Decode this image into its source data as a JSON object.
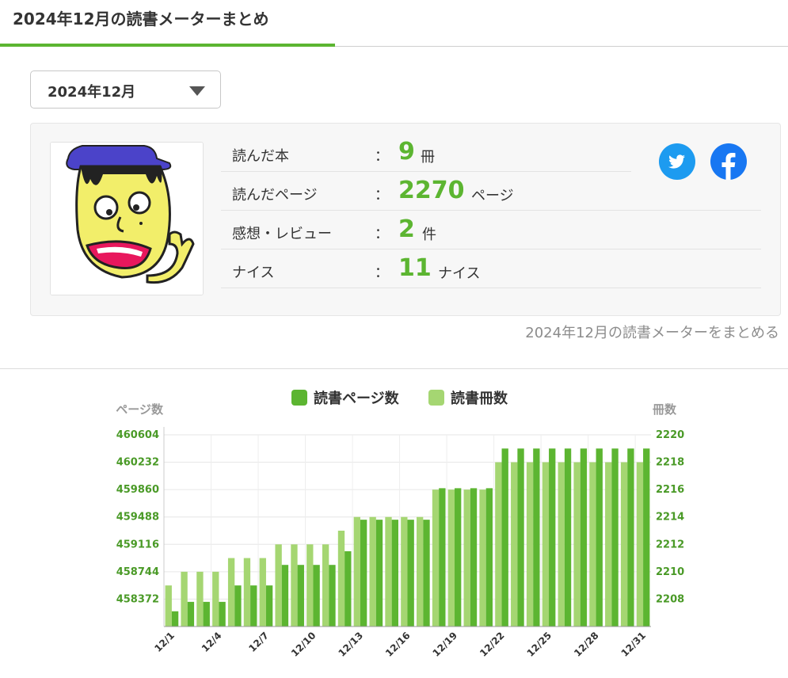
{
  "header": {
    "title": "2024年12月の読書メーターまとめ"
  },
  "month_select": {
    "value": "2024年12月"
  },
  "stats": [
    {
      "label": "読んだ本",
      "colon": "：",
      "value": "9",
      "unit": "冊"
    },
    {
      "label": "読んだページ",
      "colon": "：",
      "value": "2270",
      "unit": "ページ"
    },
    {
      "label": "感想・レビュー",
      "colon": "：",
      "value": "2",
      "unit": "件"
    },
    {
      "label": "ナイス",
      "colon": "：",
      "value": "11",
      "unit": "ナイス"
    }
  ],
  "social": [
    {
      "name": "twitter-icon"
    },
    {
      "name": "facebook-icon"
    }
  ],
  "summarize_link": "2024年12月の読書メーターをまとめる",
  "colors": {
    "accent": "#5cb531",
    "pages_series": "#5cb531",
    "books_series": "#a5d672",
    "twitter": "#1d9bf0",
    "facebook": "#1877f2"
  },
  "chart_data": {
    "type": "bar",
    "legend": [
      "読書ページ数",
      "読書冊数"
    ],
    "legend_position": "top-center",
    "ylabel_left": "ページ数",
    "ylabel_right": "冊数",
    "yticks_left": [
      "460604",
      "460232",
      "459860",
      "459488",
      "459116",
      "458744",
      "458372"
    ],
    "yticks_right": [
      "2220",
      "2218",
      "2216",
      "2214",
      "2212",
      "2210",
      "2208"
    ],
    "ylim_left": [
      458000,
      460604
    ],
    "ylim_right": [
      2206,
      2220
    ],
    "xtick_labels": [
      "12/1",
      "12/4",
      "12/7",
      "12/10",
      "12/13",
      "12/16",
      "12/19",
      "12/22",
      "12/25",
      "12/28",
      "12/31"
    ],
    "grid": true,
    "categories": [
      "12/1",
      "12/2",
      "12/3",
      "12/4",
      "12/5",
      "12/6",
      "12/7",
      "12/8",
      "12/9",
      "12/10",
      "12/11",
      "12/12",
      "12/13",
      "12/14",
      "12/15",
      "12/16",
      "12/17",
      "12/18",
      "12/19",
      "12/20",
      "12/21",
      "12/22",
      "12/23",
      "12/24",
      "12/25",
      "12/26",
      "12/27",
      "12/28",
      "12/29",
      "12/30",
      "12/31"
    ],
    "series": [
      {
        "name": "読書冊数",
        "axis": "right",
        "values": [
          2209,
          2210,
          2210,
          2210,
          2211,
          2211,
          2211,
          2212,
          2212,
          2212,
          2212,
          2213,
          2214,
          2214,
          2214,
          2214,
          2214,
          2216,
          2216,
          2216,
          2216,
          2218,
          2218,
          2218,
          2218,
          2218,
          2218,
          2218,
          2218,
          2218,
          2218
        ]
      },
      {
        "name": "読書ページ数",
        "axis": "left",
        "values": [
          458207,
          458335,
          458335,
          458335,
          458558,
          458558,
          458558,
          458837,
          458837,
          458837,
          458837,
          459023,
          459451,
          459451,
          459451,
          459451,
          459451,
          459879,
          459879,
          459879,
          459879,
          460418,
          460418,
          460418,
          460418,
          460418,
          460418,
          460418,
          460418,
          460418,
          460418
        ]
      }
    ]
  }
}
